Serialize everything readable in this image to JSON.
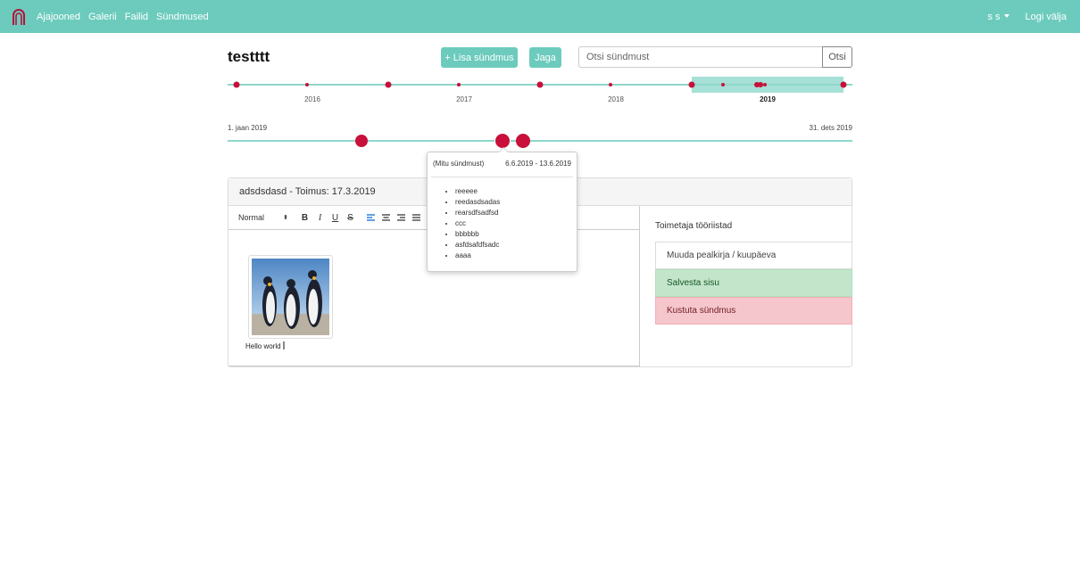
{
  "nav": {
    "items": [
      {
        "label": "Ajajooned"
      },
      {
        "label": "Galerii"
      },
      {
        "label": "Failid"
      },
      {
        "label": "Sündmused"
      }
    ],
    "user": "s s",
    "logout": "Logi välja"
  },
  "header": {
    "title": "testttt",
    "add_event": "+ Lisa sündmus",
    "share": "Jaga",
    "search_placeholder": "Otsi sündmust",
    "search_button": "Otsi"
  },
  "timeline": {
    "years": [
      "2016",
      "2017",
      "2018",
      "2019"
    ],
    "selected_year": "2019",
    "zoom_start": "1. jaan 2019",
    "zoom_end": "31. dets 2019"
  },
  "tooltip": {
    "label": "(Mitu sündmust)",
    "date_range": "6.6.2019 - 13.6.2019",
    "events": [
      "reeeee",
      "reedasdsadas",
      "rearsdfsadfsd",
      "ccc",
      "bbbbbb",
      "asfdsafdfsadc",
      "aaaa"
    ]
  },
  "event": {
    "title": "adsdsdasd - Toimus: 17.3.2019",
    "editor": {
      "format": "Normal",
      "text": "Hello world"
    }
  },
  "tools": {
    "title": "Toimetaja tööriistad",
    "edit": "Muuda pealkirja / kuupäeva",
    "save": "Salvesta sisu",
    "delete": "Kustuta sündmus"
  },
  "colors": {
    "accent": "#6ccbbd",
    "event_dot": "#c8103a"
  }
}
